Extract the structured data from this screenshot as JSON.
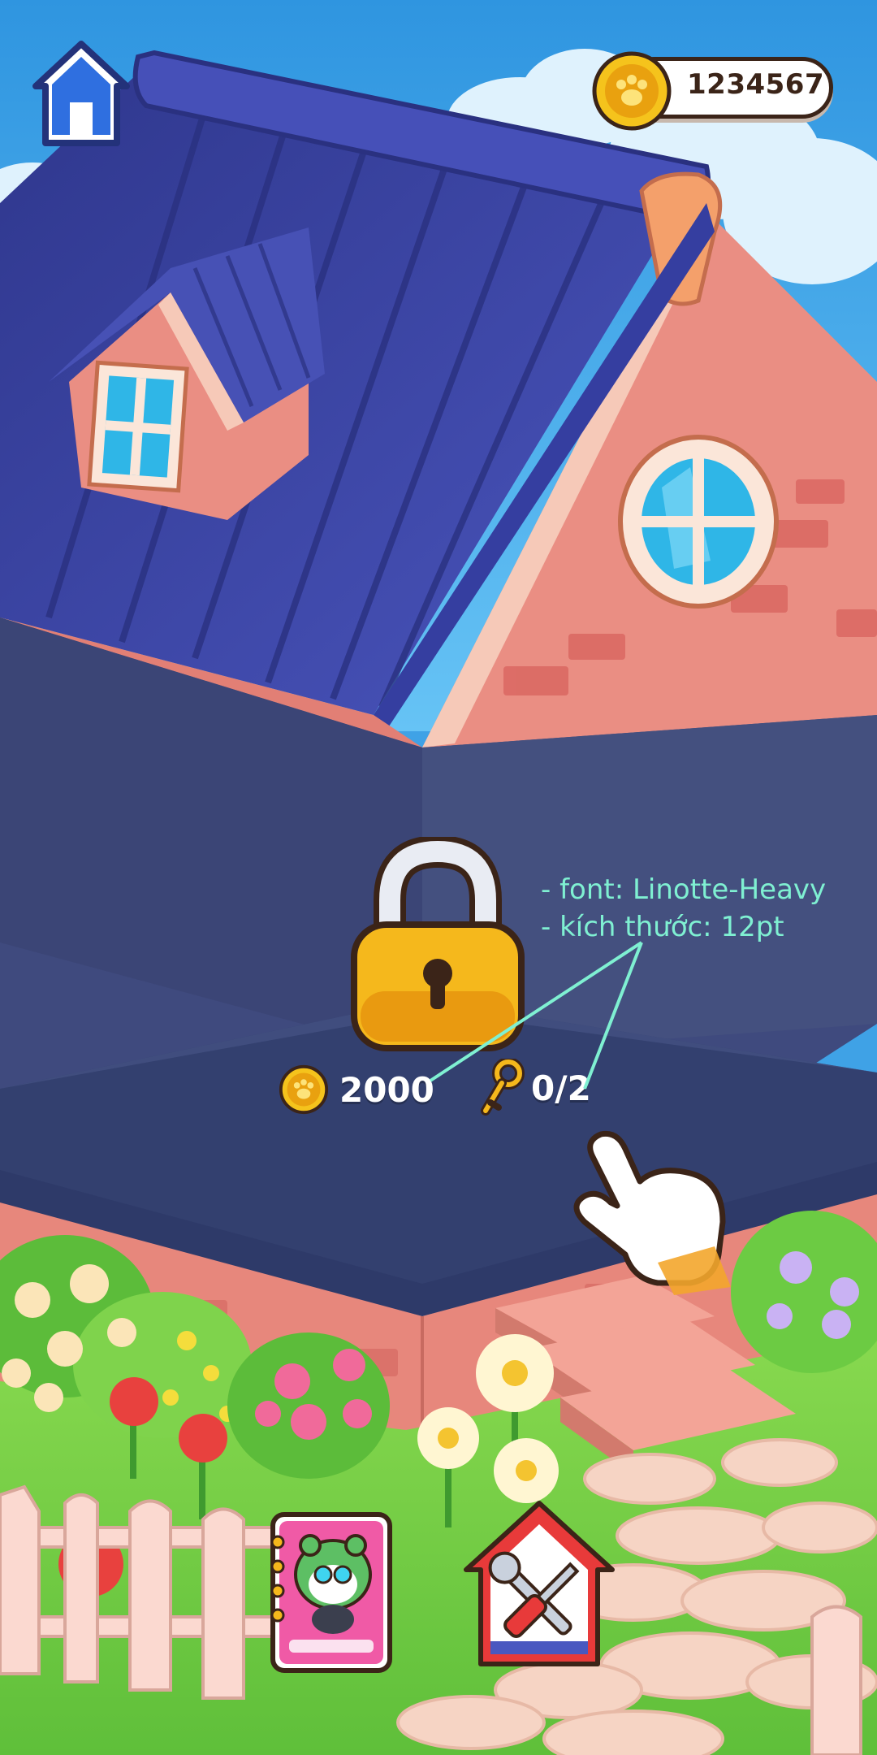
{
  "hud": {
    "home_icon": "home-icon",
    "coin_icon": "paw-coin-icon",
    "coins": "1234567"
  },
  "locked_room": {
    "lock_icon": "padlock-icon",
    "coin_cost_icon": "paw-coin-icon",
    "coin_cost": "2000",
    "key_icon": "key-icon",
    "keys_progress": "0/2"
  },
  "annotation": {
    "line1": "- font: Linotte-Heavy",
    "line2": "- kích thước: 12pt",
    "color": "#7ff0d2"
  },
  "tutorial": {
    "pointer_icon": "pointing-hand-icon"
  },
  "bottom_bar": {
    "album_icon": "album-book-icon",
    "build_icon": "build-tools-house-icon"
  },
  "colors": {
    "sky": "#3fa2e6",
    "roof": "#3f48a8",
    "brick_wall": "#e98b80",
    "room_interior": "#3b4576",
    "grass": "#7fd34c",
    "coin_gold": "#f5c31c",
    "text_dark": "#3b2418"
  }
}
